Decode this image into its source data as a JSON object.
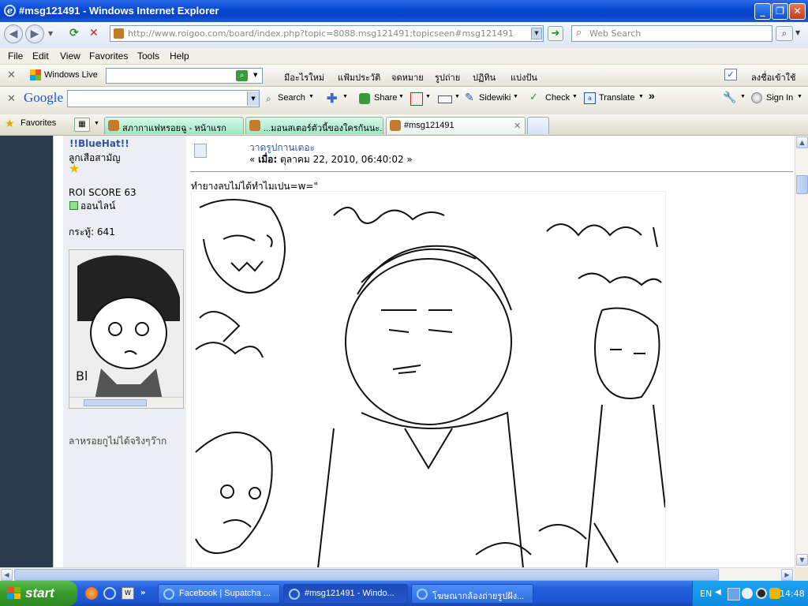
{
  "window": {
    "title": "#msg121491 - Windows Internet Explorer",
    "min": "_",
    "max": "❐",
    "close": "✕"
  },
  "address_bar": {
    "url": "http://www.roigoo.com/board/index.php?topic=8088.msg121491;topicseen#msg121491",
    "search_placeholder": "Web Search"
  },
  "menu": [
    "File",
    "Edit",
    "View",
    "Favorites",
    "Tools",
    "Help"
  ],
  "wl_toolbar": {
    "brand": "Windows Live",
    "items": [
      "มีอะไรใหม่",
      "แฟ้มประวัติ",
      "จดหมาย",
      "รูปถ่าย",
      "ปฏิทิน",
      "แบ่งปัน"
    ],
    "signin": "ลงชื่อเข้าใช้"
  },
  "google_toolbar": {
    "brand": "Google",
    "search": "Search",
    "share": "Share",
    "sidewiki": "Sidewiki",
    "check": "Check",
    "translate": "Translate",
    "signin": "Sign In"
  },
  "favorites_bar": {
    "label": "Favorites",
    "tabs": [
      {
        "label": "สภากาแฟหรอยฉู - หน้าแรก",
        "active": false
      },
      {
        "label": "...มอนสเตอร์ตัวนี้ของใครกันนะ...",
        "active": false
      },
      {
        "label": "#msg121491",
        "active": true
      }
    ]
  },
  "profile": {
    "username": "!!BlueHat!!",
    "rank": "ลูกเสือสามัญ",
    "score": "ROI SCORE 63",
    "status": "ออนไลน์",
    "posts": "กระทู้: 641",
    "signature": "ลาหรอยกูไม่ได้จริงๆว๊าก"
  },
  "post": {
    "title": "วาดรูปกานเตอะ",
    "date_prefix": "« ",
    "date_label": "เมื่อ:",
    "date": "ตุลาคม 22, 2010, 06:40:02 »",
    "body": "ทำยางลบไม่ได้ทำไมเปน=w=\""
  },
  "taskbar": {
    "start": "start",
    "tasks": [
      {
        "label": "Facebook | Supatcha ...",
        "active": false
      },
      {
        "label": "#msg121491 - Windo...",
        "active": true
      },
      {
        "label": "โฆษณากล้องถ่ายรูปฝัง...",
        "active": false
      }
    ],
    "lang": "EN",
    "clock": "14:48"
  }
}
